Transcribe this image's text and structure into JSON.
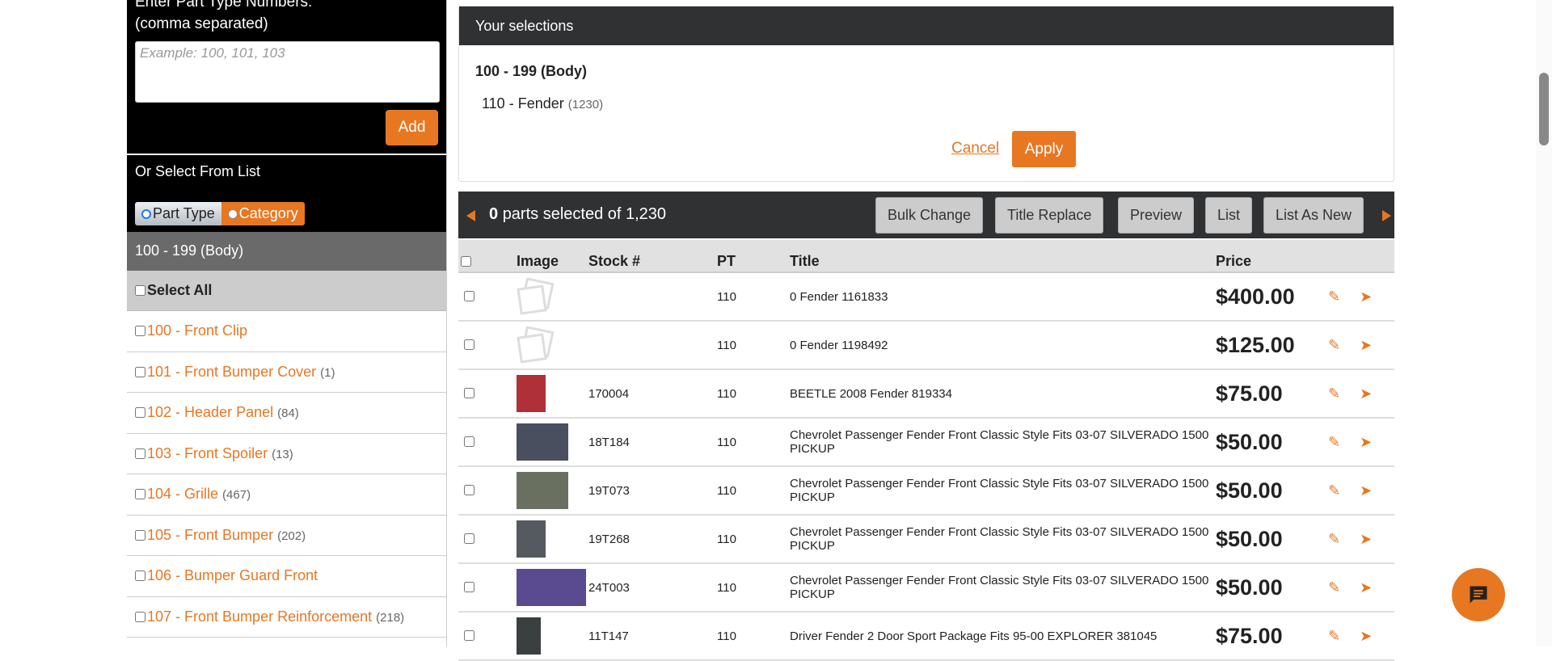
{
  "sidebar": {
    "enter_label": "Enter Part Type Numbers:",
    "comma_label": "(comma separated)",
    "placeholder": "Example: 100, 101, 103",
    "add": "Add",
    "or_select": "Or Select From List",
    "toggle": [
      "Part Type",
      "Category"
    ],
    "group": "100 - 199 (Body)",
    "select_all": "Select All",
    "items": [
      {
        "label": "100 - Front Clip",
        "count": ""
      },
      {
        "label": "101 - Front Bumper Cover",
        "count": "(1)"
      },
      {
        "label": "102 - Header Panel",
        "count": "(84)"
      },
      {
        "label": "103 - Front Spoiler",
        "count": "(13)"
      },
      {
        "label": "104 - Grille",
        "count": "(467)"
      },
      {
        "label": "105 - Front Bumper",
        "count": "(202)"
      },
      {
        "label": "106 - Bumper Guard Front",
        "count": ""
      },
      {
        "label": "107 - Front Bumper Reinforcement",
        "count": "(218)"
      }
    ]
  },
  "selections": {
    "title": "Your selections",
    "group": "100 - 199 (Body)",
    "item": "110 - Fender",
    "item_count": "(1230)",
    "cancel": "Cancel",
    "apply": "Apply"
  },
  "toolbar": {
    "selected": "0",
    "of_text": "parts selected of 1,230",
    "buttons": [
      "Bulk Change",
      "Title Replace",
      "Preview",
      "List",
      "List As New"
    ]
  },
  "table": {
    "headers": [
      "Image",
      "Stock #",
      "PT",
      "Title",
      "Price"
    ],
    "rows": [
      {
        "stock": "",
        "pt": "110",
        "title": "0 Fender 1161833",
        "price": "$400.00",
        "img": "placeholder"
      },
      {
        "stock": "",
        "pt": "110",
        "title": "0 Fender 1198492",
        "price": "$125.00",
        "img": "placeholder"
      },
      {
        "stock": "170004",
        "pt": "110",
        "title": "BEETLE 2008 Fender 819334",
        "price": "$75.00",
        "img": "#b0303a"
      },
      {
        "stock": "18T184",
        "pt": "110",
        "title": "Chevrolet Passenger Fender Front Classic Style Fits 03-07 SILVERADO 1500 PICKUP",
        "price": "$50.00",
        "img": "#4a4f60"
      },
      {
        "stock": "19T073",
        "pt": "110",
        "title": "Chevrolet Passenger Fender Front Classic Style Fits 03-07 SILVERADO 1500 PICKUP",
        "price": "$50.00",
        "img": "#6a7060"
      },
      {
        "stock": "19T268",
        "pt": "110",
        "title": "Chevrolet Passenger Fender Front Classic Style Fits 03-07 SILVERADO 1500 PICKUP",
        "price": "$50.00",
        "img": "#555a60"
      },
      {
        "stock": "24T003",
        "pt": "110",
        "title": "Chevrolet Passenger Fender Front Classic Style Fits 03-07 SILVERADO 1500 PICKUP",
        "price": "$50.00",
        "img": "#5a4a90"
      },
      {
        "stock": "11T147",
        "pt": "110",
        "title": "Driver Fender 2 Door Sport Package Fits 95-00 EXPLORER 381045",
        "price": "$75.00",
        "img": "#3a4040"
      }
    ]
  },
  "colors": {
    "accent": "#e87722",
    "dark": "#2f3133"
  }
}
